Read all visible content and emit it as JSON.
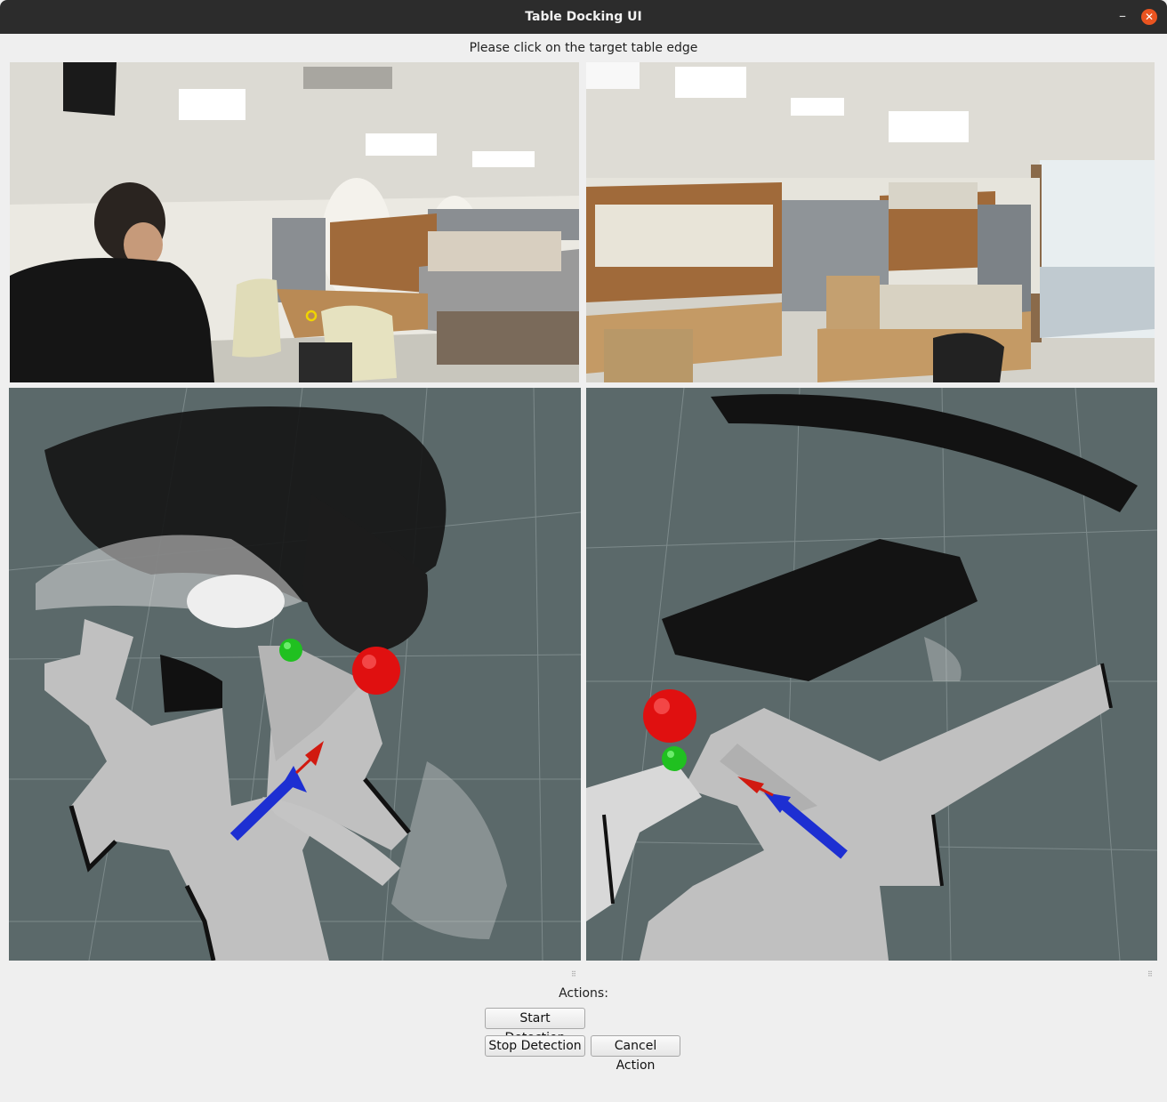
{
  "window": {
    "title": "Table Docking UI",
    "minimize_glyph": "–",
    "close_glyph": "✕"
  },
  "instruction": "Please click on the target table edge",
  "panels": {
    "left_camera": "left-camera-feed",
    "right_camera": "right-camera-feed",
    "left_map": "left-map-view",
    "right_map": "right-map-view"
  },
  "actions": {
    "label": "Actions:",
    "start_detection": "Start Detection",
    "stop_detection": "Stop Detection",
    "cancel_action": "Cancel Action"
  },
  "colors": {
    "titlebar": "#2c2c2c",
    "close_button": "#e95420",
    "map_background": "#5b696a",
    "free_space": "#c0c0c0",
    "robot_arrow": "#1d2fd2",
    "target_arrow": "#d11a10",
    "target_sphere": "#e01010",
    "marker_sphere": "#20c020",
    "click_marker": "#f0d400"
  }
}
